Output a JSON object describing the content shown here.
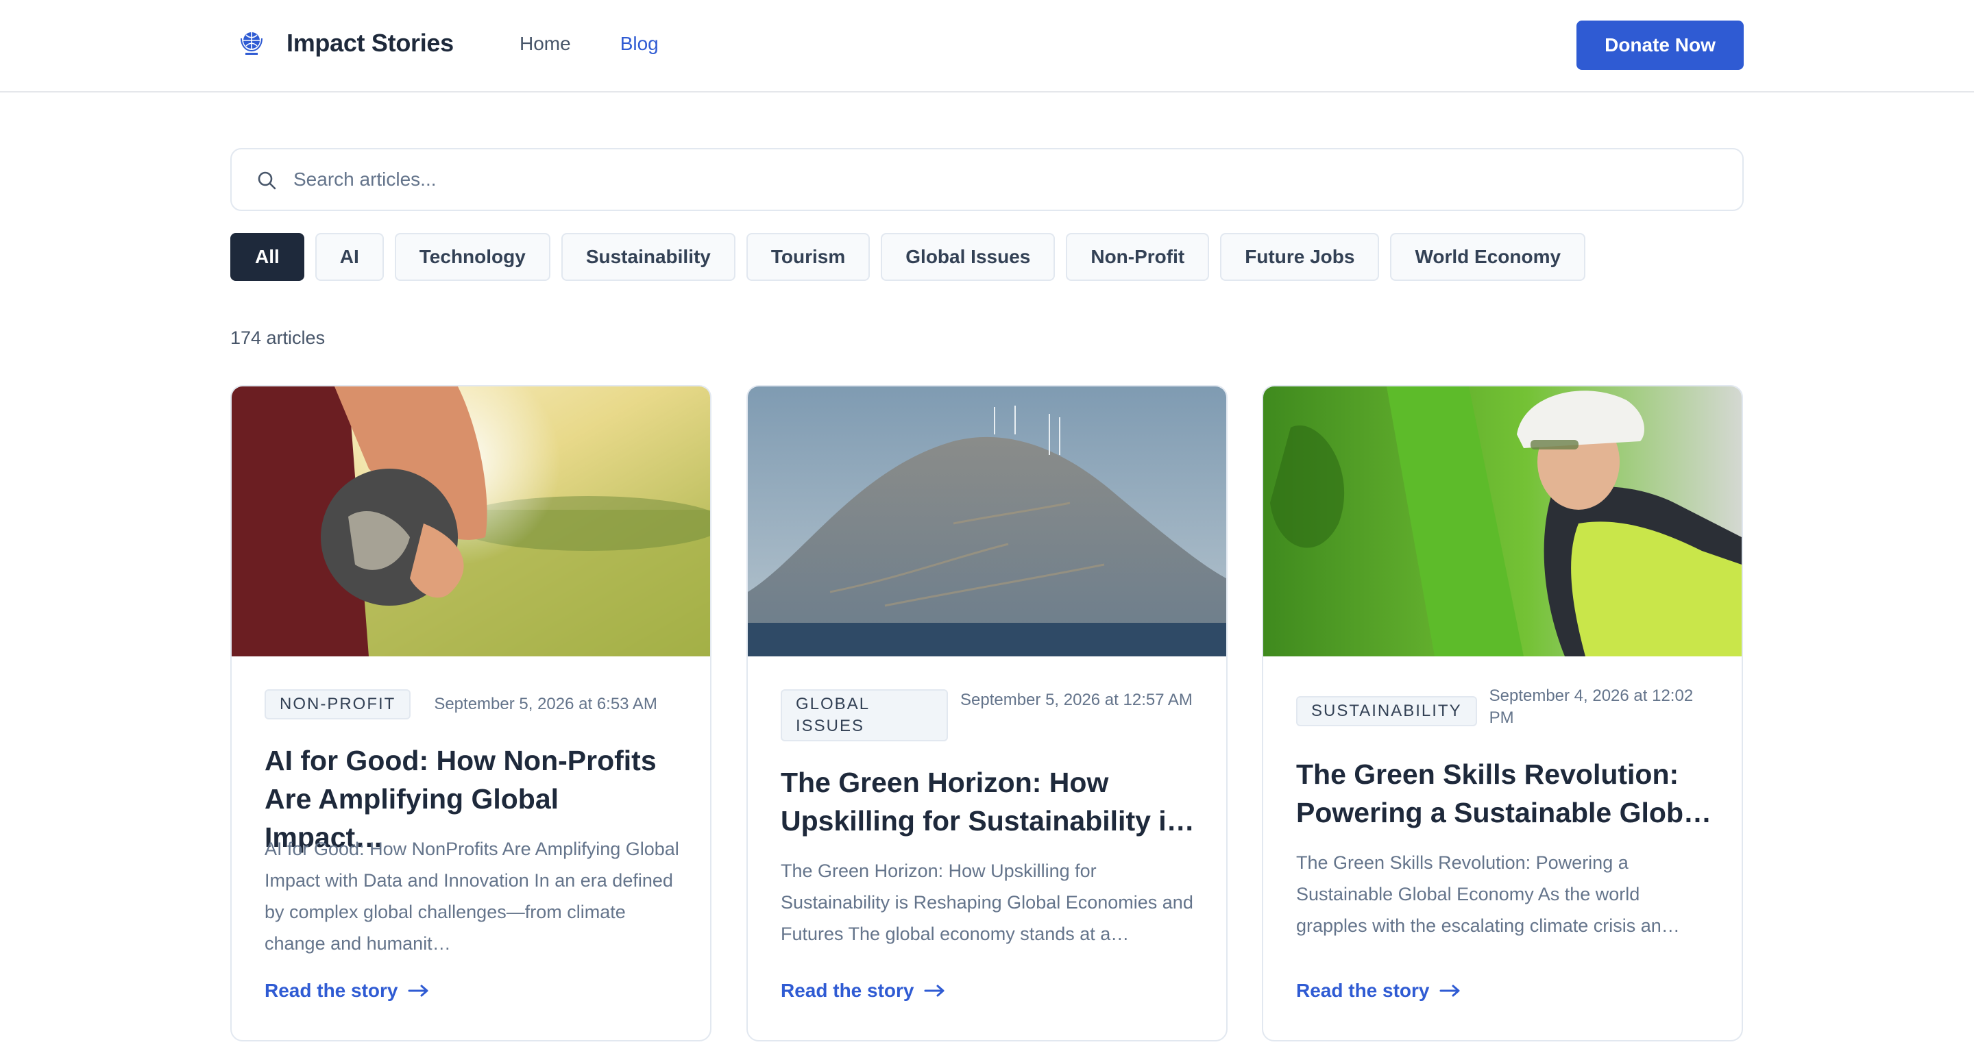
{
  "header": {
    "brand": "Impact Stories",
    "nav": [
      {
        "label": "Home",
        "active": false
      },
      {
        "label": "Blog",
        "active": true
      }
    ],
    "donate_label": "Donate Now",
    "accent_color": "#2f5bd3"
  },
  "search": {
    "placeholder": "Search articles...",
    "value": ""
  },
  "filters": [
    "All",
    "AI",
    "Technology",
    "Sustainability",
    "Tourism",
    "Global Issues",
    "Non-Profit",
    "Future Jobs",
    "World Economy"
  ],
  "active_filter": "All",
  "article_count": "174 articles",
  "articles": [
    {
      "category": "NON-PROFIT",
      "date": "September 5, 2026 at 6:53 AM",
      "title": "AI for Good: How Non-Profits Are Amplifying Global Impact…",
      "excerpt": "AI for Good: How NonProfits Are Amplifying Global Impact with Data and Innovation In an era defined by complex global challenges—from climate change and humanit…",
      "link": "Read the story",
      "image": "hand-holding-globe-photo"
    },
    {
      "category": "GLOBAL ISSUES",
      "date": "September 5, 2026 at 12:57 AM",
      "title": "The Green Horizon: How Upskilling for Sustainability i…",
      "excerpt": "The Green Horizon: How Upskilling for Sustainability is Reshaping Global Economies and Futures The global economy stands at a…",
      "link": "Read the story",
      "image": "wind-turbines-mountain-photo"
    },
    {
      "category": "SUSTAINABILITY",
      "date": "September 4, 2026 at 12:02 PM",
      "title": "The Green Skills Revolution: Powering a Sustainable Glob…",
      "excerpt": "The Green Skills Revolution: Powering a Sustainable Global Economy As the world grapples with the escalating climate crisis an…",
      "link": "Read the story",
      "image": "worker-hard-hat-photo"
    }
  ]
}
